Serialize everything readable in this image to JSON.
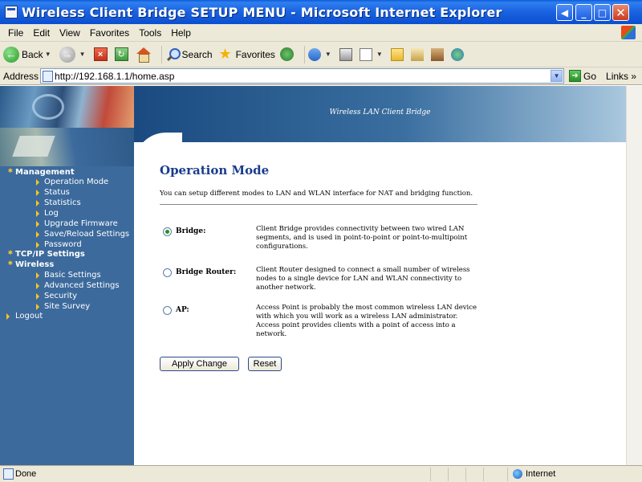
{
  "window": {
    "title": "Wireless Client Bridge SETUP MENU - Microsoft Internet Explorer"
  },
  "menubar": {
    "items": [
      "File",
      "Edit",
      "View",
      "Favorites",
      "Tools",
      "Help"
    ]
  },
  "toolbar": {
    "back_label": "Back",
    "search_label": "Search",
    "favorites_label": "Favorites",
    "icons": [
      "back-icon",
      "forward-icon",
      "stop-icon",
      "refresh-icon",
      "home-icon",
      "search-icon",
      "favorites-icon",
      "media-icon",
      "history-icon",
      "mail-icon",
      "print-icon",
      "edit-icon",
      "folder-icon",
      "research-icon",
      "messenger-icon"
    ]
  },
  "addressbar": {
    "label": "Address",
    "url": "http://192.168.1.1/home.asp",
    "go_label": "Go",
    "links_label": "Links"
  },
  "banner": {
    "text": "Wireless LAN Client Bridge"
  },
  "sidebar": {
    "sections": [
      {
        "label": "Management",
        "items": [
          "Operation Mode",
          "Status",
          "Statistics",
          "Log",
          "Upgrade Firmware",
          "Save/Reload Settings",
          "Password"
        ]
      },
      {
        "label": "TCP/IP Settings",
        "items": []
      },
      {
        "label": "Wireless",
        "items": [
          "Basic Settings",
          "Advanced Settings",
          "Security",
          "Site Survey"
        ]
      }
    ],
    "logout_label": "Logout"
  },
  "main": {
    "title": "Operation Mode",
    "description": "You can setup different modes to LAN and WLAN interface for NAT and bridging function.",
    "modes": [
      {
        "label": "Bridge:",
        "checked": true,
        "description": "Client Bridge provides connectivity between two wired LAN segments, and is used in point-to-point or point-to-multipoint configurations."
      },
      {
        "label": "Bridge Router:",
        "checked": false,
        "description": "Client Router designed to connect a small number of wireless nodes to a single device for LAN and WLAN connectivity to another network."
      },
      {
        "label": "AP:",
        "checked": false,
        "description": "Access Point is probably the most common wireless LAN device with which you will work as a wireless LAN administrator. Access point provides clients with a point of access into a network."
      }
    ],
    "apply_label": "Apply Change",
    "reset_label": "Reset"
  },
  "statusbar": {
    "status": "Done",
    "zone": "Internet"
  }
}
